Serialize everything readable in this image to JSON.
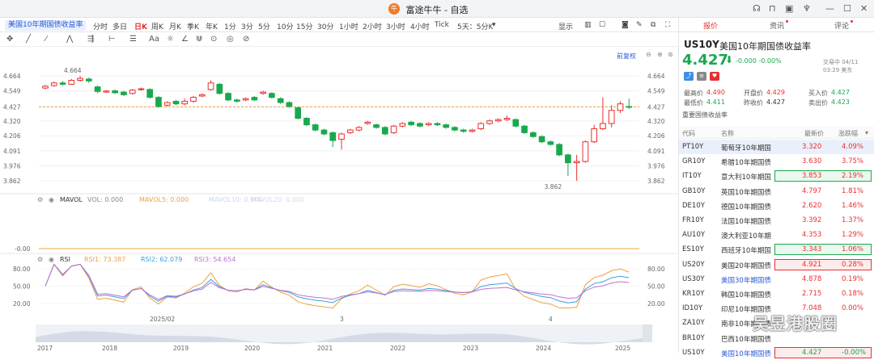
{
  "window": {
    "title": "富途牛牛 - 自选",
    "logo_glyph": "牛"
  },
  "toolbar": {
    "active_tab": "美国10年期国债收益率",
    "timeframes": [
      "分时",
      "多日",
      "日K",
      "周K",
      "月K",
      "季K",
      "年K",
      "1分",
      "3分",
      "5分",
      "10分",
      "15分",
      "30分",
      "1小时",
      "2小时",
      "3小时",
      "4小时",
      "Tick",
      "5天：5分K"
    ],
    "active_timeframe": "日K",
    "display_label": "显示"
  },
  "chart": {
    "fq_label": "前复权",
    "price_ticks": [
      "4.664",
      "4.549",
      "4.427",
      "4.320",
      "4.206",
      "4.091",
      "3.976",
      "3.862"
    ],
    "high_label": "4.664",
    "low_label": "3.862",
    "mavol": {
      "name": "MAVOL",
      "vol": "VOL: 0.000",
      "mavol5": "MAVOL5: 0.000",
      "mavol10": "MAVOL10: 0.000",
      "mavol20": "MAVOL20: 0.000",
      "axis": "-0.00"
    },
    "rsi": {
      "name": "RSI",
      "rsi1": "RSI1: 73.387",
      "rsi2": "RSI2: 62.079",
      "rsi3": "RSI3: 54.654",
      "ticks": [
        "80.00",
        "50.00",
        "20.00"
      ]
    },
    "month_labels": [
      "2025/02",
      "3",
      "4"
    ],
    "year_labels": [
      "2017",
      "2018",
      "2019",
      "2020",
      "2021",
      "2022",
      "2023",
      "2024",
      "2025"
    ]
  },
  "candles": [
    {
      "o": 4.571,
      "c": 4.585,
      "h": 4.595,
      "l": 4.56
    },
    {
      "o": 4.59,
      "c": 4.61,
      "h": 4.62,
      "l": 4.58
    },
    {
      "o": 4.61,
      "c": 4.6,
      "h": 4.625,
      "l": 4.59
    },
    {
      "o": 4.6,
      "c": 4.63,
      "h": 4.64,
      "l": 4.595
    },
    {
      "o": 4.63,
      "c": 4.645,
      "h": 4.664,
      "l": 4.62
    },
    {
      "o": 4.64,
      "c": 4.625,
      "h": 4.65,
      "l": 4.61
    },
    {
      "o": 4.58,
      "c": 4.545,
      "h": 4.59,
      "l": 4.53
    },
    {
      "o": 4.54,
      "c": 4.548,
      "h": 4.555,
      "l": 4.535
    },
    {
      "o": 4.55,
      "c": 4.535,
      "h": 4.56,
      "l": 4.525
    },
    {
      "o": 4.54,
      "c": 4.52,
      "h": 4.55,
      "l": 4.51
    },
    {
      "o": 4.53,
      "c": 4.555,
      "h": 4.565,
      "l": 4.52
    },
    {
      "o": 4.56,
      "c": 4.565,
      "h": 4.575,
      "l": 4.55
    },
    {
      "o": 4.56,
      "c": 4.5,
      "h": 4.57,
      "l": 4.49
    },
    {
      "o": 4.5,
      "c": 4.43,
      "h": 4.51,
      "l": 4.42
    },
    {
      "o": 4.44,
      "c": 4.46,
      "h": 4.47,
      "l": 4.43
    },
    {
      "o": 4.47,
      "c": 4.45,
      "h": 4.48,
      "l": 4.44
    },
    {
      "o": 4.45,
      "c": 4.47,
      "h": 4.49,
      "l": 4.44
    },
    {
      "o": 4.47,
      "c": 4.5,
      "h": 4.51,
      "l": 4.46
    },
    {
      "o": 4.51,
      "c": 4.52,
      "h": 4.53,
      "l": 4.5
    },
    {
      "o": 4.56,
      "c": 4.61,
      "h": 4.63,
      "l": 4.55
    },
    {
      "o": 4.6,
      "c": 4.53,
      "h": 4.61,
      "l": 4.52
    },
    {
      "o": 4.53,
      "c": 4.48,
      "h": 4.54,
      "l": 4.47
    },
    {
      "o": 4.48,
      "c": 4.47,
      "h": 4.49,
      "l": 4.46
    },
    {
      "o": 4.48,
      "c": 4.49,
      "h": 4.5,
      "l": 4.47
    },
    {
      "o": 4.5,
      "c": 4.48,
      "h": 4.51,
      "l": 4.47
    },
    {
      "o": 4.53,
      "c": 4.54,
      "h": 4.55,
      "l": 4.52
    },
    {
      "o": 4.53,
      "c": 4.5,
      "h": 4.54,
      "l": 4.49
    },
    {
      "o": 4.49,
      "c": 4.46,
      "h": 4.5,
      "l": 4.45
    },
    {
      "o": 4.46,
      "c": 4.43,
      "h": 4.47,
      "l": 4.42
    },
    {
      "o": 4.42,
      "c": 4.34,
      "h": 4.43,
      "l": 4.33
    },
    {
      "o": 4.34,
      "c": 4.29,
      "h": 4.35,
      "l": 4.28
    },
    {
      "o": 4.29,
      "c": 4.25,
      "h": 4.3,
      "l": 4.24
    },
    {
      "o": 4.25,
      "c": 4.22,
      "h": 4.26,
      "l": 4.21
    },
    {
      "o": 4.23,
      "c": 4.17,
      "h": 4.24,
      "l": 4.12
    },
    {
      "o": 4.18,
      "c": 4.22,
      "h": 4.23,
      "l": 4.1
    },
    {
      "o": 4.23,
      "c": 4.25,
      "h": 4.26,
      "l": 4.22
    },
    {
      "o": 4.25,
      "c": 4.27,
      "h": 4.28,
      "l": 4.24
    },
    {
      "o": 4.3,
      "c": 4.31,
      "h": 4.32,
      "l": 4.29
    },
    {
      "o": 4.29,
      "c": 4.27,
      "h": 4.3,
      "l": 4.26
    },
    {
      "o": 4.27,
      "c": 4.22,
      "h": 4.28,
      "l": 4.21
    },
    {
      "o": 4.23,
      "c": 4.28,
      "h": 4.29,
      "l": 4.22
    },
    {
      "o": 4.28,
      "c": 4.3,
      "h": 4.31,
      "l": 4.27
    },
    {
      "o": 4.31,
      "c": 4.29,
      "h": 4.32,
      "l": 4.28
    },
    {
      "o": 4.3,
      "c": 4.28,
      "h": 4.31,
      "l": 4.27
    },
    {
      "o": 4.29,
      "c": 4.3,
      "h": 4.31,
      "l": 4.28
    },
    {
      "o": 4.3,
      "c": 4.29,
      "h": 4.31,
      "l": 4.28
    },
    {
      "o": 4.29,
      "c": 4.27,
      "h": 4.3,
      "l": 4.26
    },
    {
      "o": 4.27,
      "c": 4.25,
      "h": 4.28,
      "l": 4.24
    },
    {
      "o": 4.25,
      "c": 4.24,
      "h": 4.26,
      "l": 4.23
    },
    {
      "o": 4.24,
      "c": 4.25,
      "h": 4.26,
      "l": 4.23
    },
    {
      "o": 4.26,
      "c": 4.3,
      "h": 4.31,
      "l": 4.25
    },
    {
      "o": 4.3,
      "c": 4.32,
      "h": 4.33,
      "l": 4.29
    },
    {
      "o": 4.32,
      "c": 4.33,
      "h": 4.34,
      "l": 4.31
    },
    {
      "o": 4.33,
      "c": 4.34,
      "h": 4.36,
      "l": 4.32
    },
    {
      "o": 4.33,
      "c": 4.28,
      "h": 4.34,
      "l": 4.27
    },
    {
      "o": 4.28,
      "c": 4.23,
      "h": 4.29,
      "l": 4.22
    },
    {
      "o": 4.23,
      "c": 4.2,
      "h": 4.24,
      "l": 4.19
    },
    {
      "o": 4.2,
      "c": 4.16,
      "h": 4.21,
      "l": 4.15
    },
    {
      "o": 4.16,
      "c": 4.14,
      "h": 4.17,
      "l": 4.13
    },
    {
      "o": 4.14,
      "c": 4.06,
      "h": 4.15,
      "l": 4.05
    },
    {
      "o": 4.06,
      "c": 4.0,
      "h": 4.07,
      "l": 3.9
    },
    {
      "o": 4.0,
      "c": 4.01,
      "h": 4.06,
      "l": 3.862
    },
    {
      "o": 4.01,
      "c": 4.16,
      "h": 4.17,
      "l": 4.0
    },
    {
      "o": 4.16,
      "c": 4.26,
      "h": 4.29,
      "l": 4.15
    },
    {
      "o": 4.26,
      "c": 4.3,
      "h": 4.5,
      "l": 4.25
    },
    {
      "o": 4.3,
      "c": 4.4,
      "h": 4.44,
      "l": 4.27
    },
    {
      "o": 4.4,
      "c": 4.45,
      "h": 4.47,
      "l": 4.38
    },
    {
      "o": 4.43,
      "c": 4.427,
      "h": 4.49,
      "l": 4.411
    }
  ],
  "symbol": {
    "code": "US10Y",
    "name": "美国10年期国债收益率",
    "price": "4.427",
    "arrow": "⬇",
    "change": "-0.000  -0.00%",
    "time": "交易中 04/11 03:29 美东"
  },
  "right_tabs": [
    "报价",
    "资讯",
    "评论"
  ],
  "quote": [
    {
      "label": "最高价",
      "value": "4.490",
      "color": "#e93030"
    },
    {
      "label": "开盘价",
      "value": "4.429",
      "color": "#e93030"
    },
    {
      "label": "买入价",
      "value": "4.427",
      "color": "#19a84f"
    },
    {
      "label": "最低价",
      "value": "4.411",
      "color": "#19a84f"
    },
    {
      "label": "昨收价",
      "value": "4.427",
      "color": "#333333"
    },
    {
      "label": "卖出价",
      "value": "4.423",
      "color": "#19a84f"
    }
  ],
  "section_title": "重要国债收益率",
  "table": {
    "headers": [
      "代码",
      "名称",
      "最新价",
      "涨跌幅"
    ],
    "rows": [
      {
        "code": "PT10Y",
        "name": "葡萄牙10年期国",
        "price": "3.320",
        "chg": "4.09%",
        "dir": "up",
        "sel": true,
        "box": ""
      },
      {
        "code": "GR10Y",
        "name": "希腊10年期国债",
        "price": "3.630",
        "chg": "3.75%",
        "dir": "up",
        "sel": false,
        "box": ""
      },
      {
        "code": "IT10Y",
        "name": "意大利10年期国",
        "price": "3.853",
        "chg": "2.19%",
        "dir": "up",
        "sel": false,
        "box": "g"
      },
      {
        "code": "GB10Y",
        "name": "英国10年期国债",
        "price": "4.797",
        "chg": "1.81%",
        "dir": "up",
        "sel": false,
        "box": ""
      },
      {
        "code": "DE10Y",
        "name": "德国10年期国债",
        "price": "2.620",
        "chg": "1.46%",
        "dir": "up",
        "sel": false,
        "box": ""
      },
      {
        "code": "FR10Y",
        "name": "法国10年期国债",
        "price": "3.392",
        "chg": "1.37%",
        "dir": "up",
        "sel": false,
        "box": ""
      },
      {
        "code": "AU10Y",
        "name": "澳大利亚10年期",
        "price": "4.353",
        "chg": "1.29%",
        "dir": "up",
        "sel": false,
        "box": ""
      },
      {
        "code": "ES10Y",
        "name": "西班牙10年期国",
        "price": "3.343",
        "chg": "1.06%",
        "dir": "up",
        "sel": false,
        "box": "g"
      },
      {
        "code": "US20Y",
        "name": "美国20年期国债",
        "price": "4.921",
        "chg": "0.28%",
        "dir": "up",
        "sel": false,
        "box": "r"
      },
      {
        "code": "US30Y",
        "name": "美国30年期国债",
        "price": "4.878",
        "chg": "0.19%",
        "dir": "up",
        "sel": false,
        "box": "",
        "blue": true
      },
      {
        "code": "KR10Y",
        "name": "韩国10年期国债",
        "price": "2.715",
        "chg": "0.18%",
        "dir": "up",
        "sel": false,
        "box": ""
      },
      {
        "code": "ID10Y",
        "name": "印尼10年期国债",
        "price": "7.048",
        "chg": "0.00%",
        "dir": "up",
        "sel": false,
        "box": ""
      },
      {
        "code": "ZA10Y",
        "name": "南非10年期国债",
        "price": "",
        "chg": "",
        "dir": "up",
        "sel": false,
        "box": ""
      },
      {
        "code": "BR10Y",
        "name": "巴西10年期国债",
        "price": "",
        "chg": "",
        "dir": "up",
        "sel": false,
        "box": ""
      },
      {
        "code": "US10Y",
        "name": "美国10年期国债",
        "price": "4.427",
        "chg": "-0.00%",
        "dir": "down",
        "sel": false,
        "box": "r",
        "blue": true
      }
    ]
  },
  "watermark": "吴昱港股圈",
  "colors": {
    "up": "#e93030",
    "down": "#19a84f",
    "rsi1": "#f0a040",
    "rsi2": "#3aa0e0",
    "rsi3": "#c070d0",
    "accent": "#2a5bd7"
  }
}
